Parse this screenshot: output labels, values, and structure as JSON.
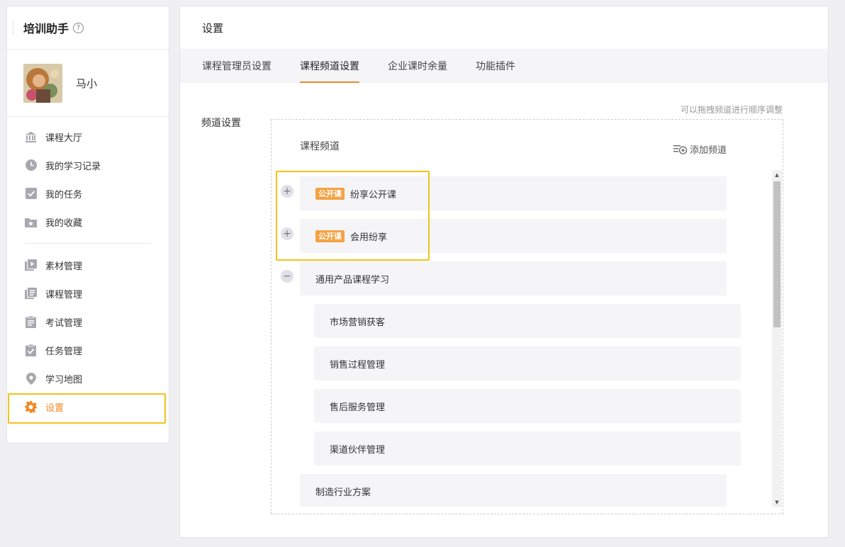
{
  "sidebar": {
    "app_title": "培训助手",
    "help_icon": "?",
    "user_name": "马小",
    "menu_group1": [
      {
        "label": "课程大厅",
        "icon": "bank-icon"
      },
      {
        "label": "我的学习记录",
        "icon": "clock-icon"
      },
      {
        "label": "我的任务",
        "icon": "checkbox-icon"
      },
      {
        "label": "我的收藏",
        "icon": "star-folder-icon"
      }
    ],
    "menu_group2": [
      {
        "label": "素材管理",
        "icon": "media-icon"
      },
      {
        "label": "课程管理",
        "icon": "course-icon"
      },
      {
        "label": "考试管理",
        "icon": "exam-icon"
      },
      {
        "label": "任务管理",
        "icon": "task-icon"
      },
      {
        "label": "学习地图",
        "icon": "map-pin-icon"
      },
      {
        "label": "设置",
        "icon": "gear-icon",
        "active": true
      }
    ]
  },
  "main": {
    "page_title": "设置",
    "tabs": [
      {
        "label": "课程管理员设置"
      },
      {
        "label": "课程频道设置",
        "active": true
      },
      {
        "label": "企业课时余量"
      },
      {
        "label": "功能插件"
      }
    ],
    "section_label": "频道设置",
    "drag_hint": "可以拖拽频道进行顺序调整",
    "box_title": "课程频道",
    "add_channel": "添加频道",
    "public_tag": "公开课",
    "channels": [
      {
        "label": "纷享公开课",
        "public": true,
        "toggle": "+"
      },
      {
        "label": "会用纷享",
        "public": true,
        "toggle": "+"
      },
      {
        "label": "通用产品课程学习",
        "public": false,
        "toggle": "−"
      },
      {
        "label": "市场营销获客",
        "child": true
      },
      {
        "label": "销售过程管理",
        "child": true
      },
      {
        "label": "售后服务管理",
        "child": true
      },
      {
        "label": "渠道伙伴管理",
        "child": true
      },
      {
        "label": "制造行业方案",
        "public": false
      }
    ]
  },
  "colors": {
    "accent": "#f08a24",
    "highlight": "#f3c21b",
    "tag": "#f5a243",
    "row_bg": "#f5f5f8"
  }
}
